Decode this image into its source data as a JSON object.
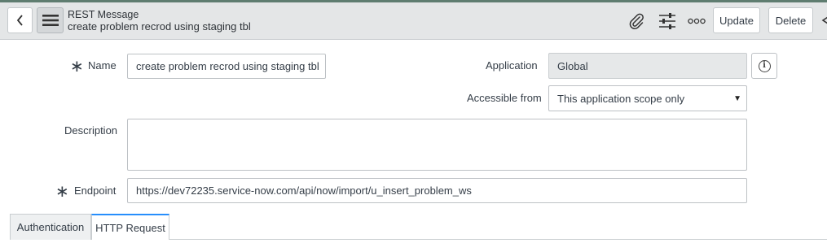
{
  "header": {
    "title": "REST Message",
    "subtitle": "create problem recrod using staging tbl",
    "icons": [
      "back-icon",
      "hamburger-menu-icon",
      "paperclip-icon",
      "sliders-icon",
      "more-dots-icon"
    ],
    "update_label": "Update",
    "delete_label": "Delete"
  },
  "form": {
    "name_label": "Name",
    "name_value": "create problem recrod using staging tbl",
    "application_label": "Application",
    "application_value": "Global",
    "accessible_label": "Accessible from",
    "accessible_value": "This application scope only",
    "description_label": "Description",
    "description_value": "",
    "endpoint_label": "Endpoint",
    "endpoint_value": "https://dev72235.service-now.com/api/now/import/u_insert_problem_ws",
    "required_marker": "∗"
  },
  "tabs": [
    {
      "label": "Authentication"
    },
    {
      "label": "HTTP Request"
    }
  ],
  "colors": {
    "header_bg": "#e4e6e7",
    "top_accent": "#5f7d70",
    "active_tab_accent": "#278efc",
    "readonly_bg": "#e6e8e9"
  }
}
